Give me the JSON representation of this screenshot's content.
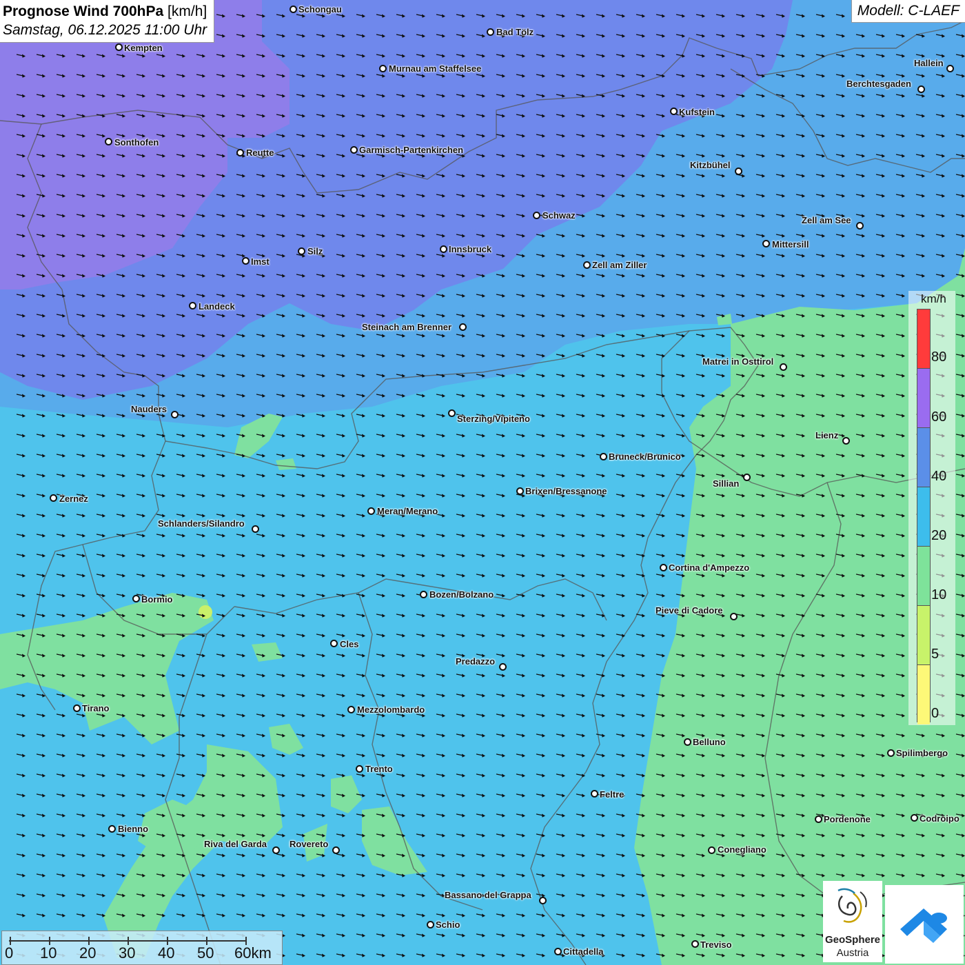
{
  "title": {
    "label": "Prognose Wind 700hPa",
    "unit": "[km/h]",
    "date": "Samstag, 06.12.2025 11:00 Uhr"
  },
  "model": "Modell: C-LAEF",
  "legend": {
    "unit": "km/h",
    "labels": [
      "80",
      "60",
      "40",
      "20",
      "10",
      "5",
      "0"
    ],
    "colors": [
      "#ff3b3b",
      "#9a6cf0",
      "#5b8fe8",
      "#3dbdec",
      "#7ee39a",
      "#c8f36a",
      "#fdf878"
    ]
  },
  "scale": {
    "labels": [
      "0",
      "10",
      "20",
      "30",
      "40",
      "50",
      "60km"
    ]
  },
  "logo": {
    "name_line1": "GeoSphere",
    "name_line2": "Austria"
  },
  "field_colors": {
    "purple": "#8d7fea",
    "violet_blue": "#6f87ec",
    "blue": "#57abeb",
    "cyan": "#4fc3ec",
    "green": "#7fe0a0"
  },
  "wind_direction": "east-southeast",
  "cities": [
    {
      "name": "Schongau"
    },
    {
      "name": "Bad Tölz"
    },
    {
      "name": "Kempten"
    },
    {
      "name": "Murnau am Staffelsee"
    },
    {
      "name": "Hallein"
    },
    {
      "name": "Berchtesgaden"
    },
    {
      "name": "Kufstein"
    },
    {
      "name": "Sonthofen"
    },
    {
      "name": "Reutte"
    },
    {
      "name": "Garmisch-Partenkirchen"
    },
    {
      "name": "Kitzbühel"
    },
    {
      "name": "Schwaz"
    },
    {
      "name": "Zell am See"
    },
    {
      "name": "Mittersill"
    },
    {
      "name": "Innsbruck"
    },
    {
      "name": "Silz"
    },
    {
      "name": "Imst"
    },
    {
      "name": "Zell am Ziller"
    },
    {
      "name": "Landeck"
    },
    {
      "name": "Steinach am Brenner"
    },
    {
      "name": "Matrei in Osttirol"
    },
    {
      "name": "Nauders"
    },
    {
      "name": "Sterzing/Vipiteno"
    },
    {
      "name": "Lienz"
    },
    {
      "name": "Bruneck/Brunico"
    },
    {
      "name": "Sillian"
    },
    {
      "name": "Zernez"
    },
    {
      "name": "Brixen/Bressanone"
    },
    {
      "name": "Meran/Merano"
    },
    {
      "name": "Schlanders/Silandro"
    },
    {
      "name": "Cortina d'Ampezzo"
    },
    {
      "name": "Bozen/Bolzano"
    },
    {
      "name": "Bormio"
    },
    {
      "name": "Pieve di Cadore"
    },
    {
      "name": "Cles"
    },
    {
      "name": "Predazzo"
    },
    {
      "name": "Tirano"
    },
    {
      "name": "Mezzolombardo"
    },
    {
      "name": "Belluno"
    },
    {
      "name": "Spilimbergo"
    },
    {
      "name": "Trento"
    },
    {
      "name": "Feltre"
    },
    {
      "name": "Pordenone"
    },
    {
      "name": "Codroipo"
    },
    {
      "name": "Bienno"
    },
    {
      "name": "Riva del Garda"
    },
    {
      "name": "Rovereto"
    },
    {
      "name": "Conegliano"
    },
    {
      "name": "Bassano del Grappa"
    },
    {
      "name": "Schio"
    },
    {
      "name": "Treviso"
    },
    {
      "name": "Cittadella"
    }
  ]
}
